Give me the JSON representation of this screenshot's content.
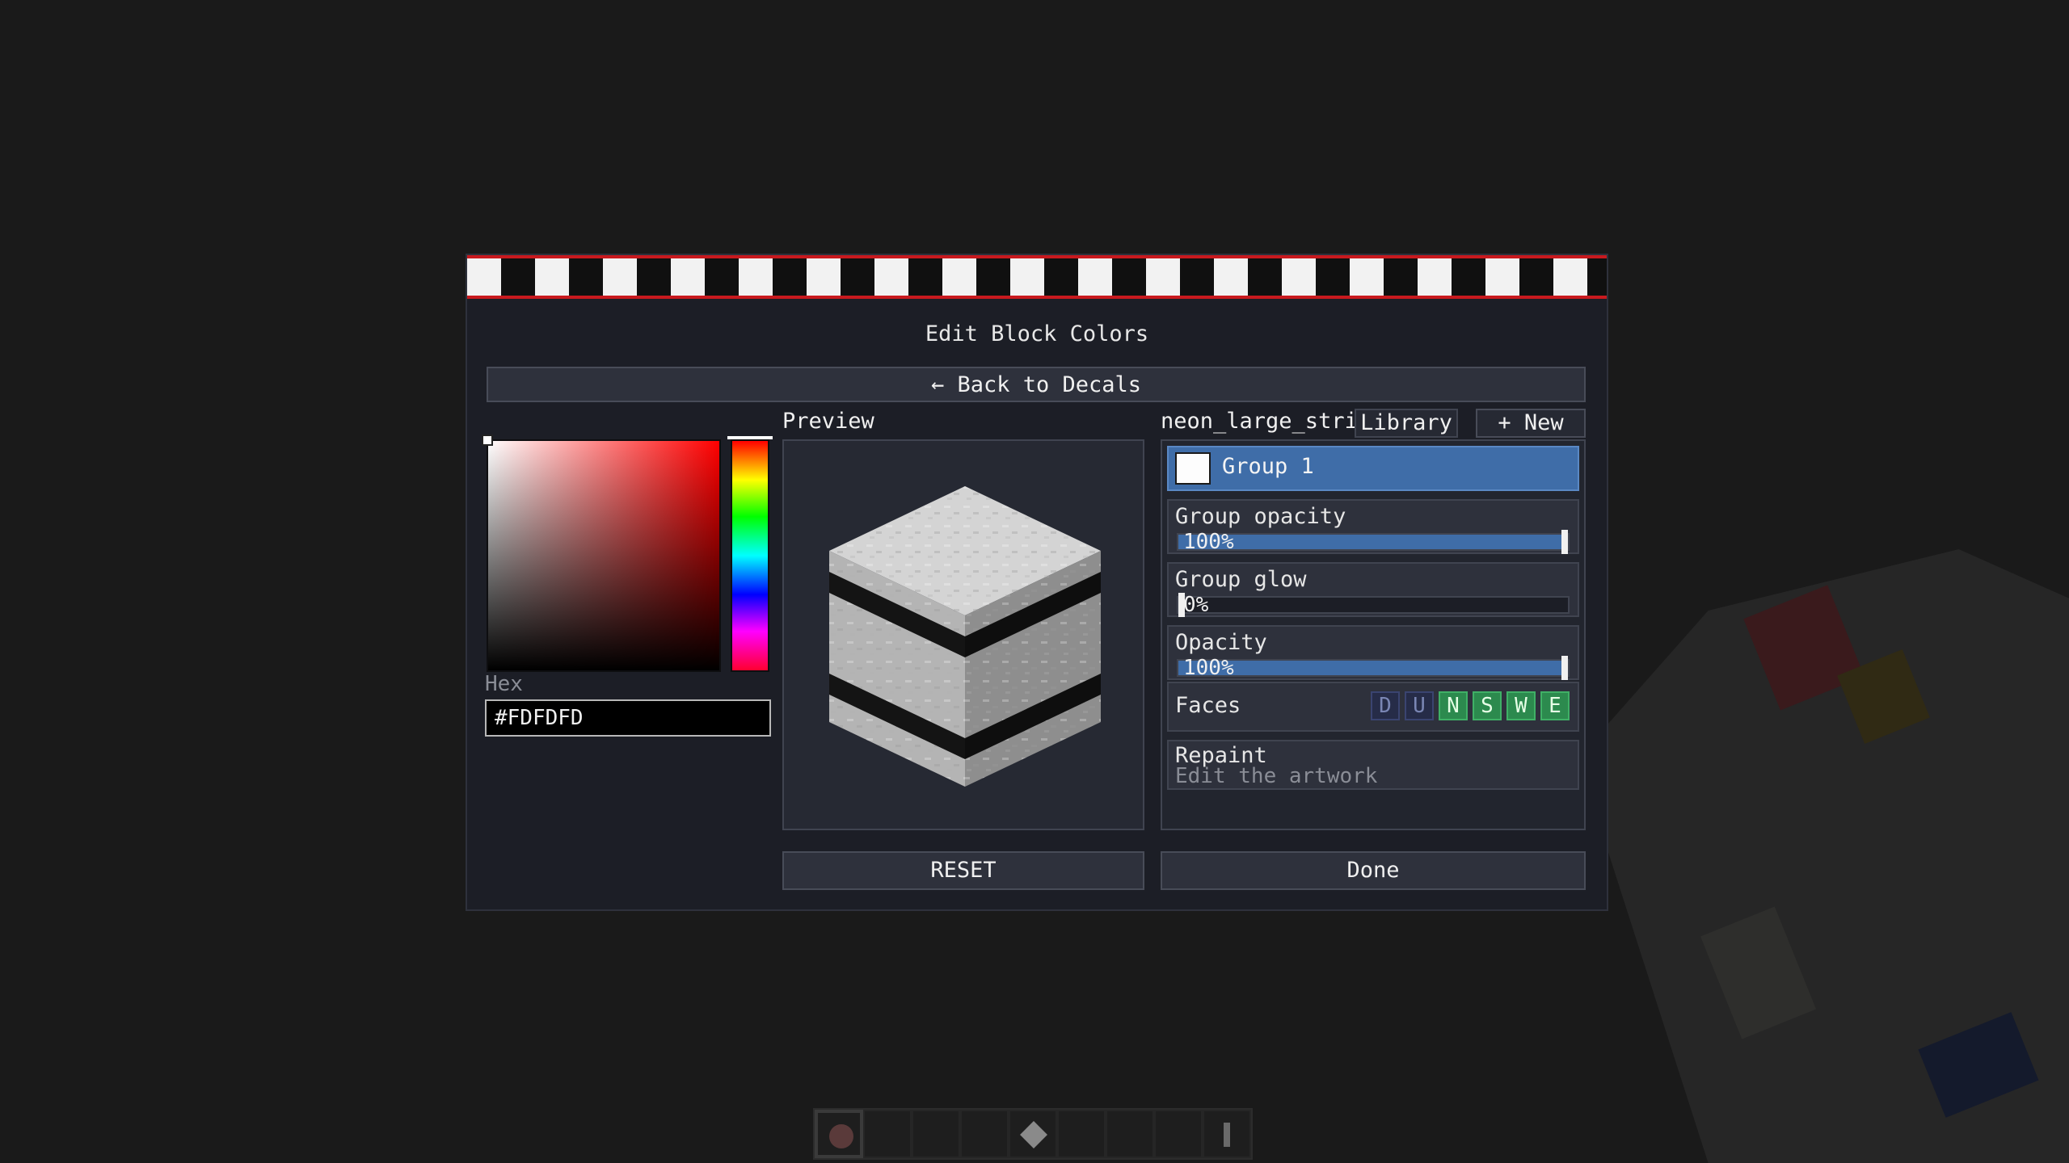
{
  "dialog": {
    "title": "Edit Block Colors",
    "back_label": "← Back to Decals"
  },
  "picker": {
    "hex_label": "Hex",
    "hex_value": "#FDFDFD"
  },
  "preview": {
    "label": "Preview"
  },
  "decal": {
    "name": "neon_large_strip",
    "library_label": "Library",
    "new_label": "+ New"
  },
  "group": {
    "name": "Group 1",
    "color": "#FDFDFD"
  },
  "sliders": {
    "group_opacity": {
      "label": "Group opacity",
      "value_text": "100%",
      "value": 1.0
    },
    "group_glow": {
      "label": "Group glow",
      "value_text": "0%",
      "value": 0.0
    },
    "opacity": {
      "label": "Opacity",
      "value_text": "100%",
      "value": 1.0
    }
  },
  "faces": {
    "label": "Faces",
    "buttons": [
      {
        "letter": "D",
        "enabled": false
      },
      {
        "letter": "U",
        "enabled": false
      },
      {
        "letter": "N",
        "enabled": true
      },
      {
        "letter": "S",
        "enabled": true
      },
      {
        "letter": "W",
        "enabled": true
      },
      {
        "letter": "E",
        "enabled": true
      }
    ]
  },
  "repaint": {
    "title": "Repaint",
    "subtitle": "Edit the artwork"
  },
  "buttons": {
    "reset_label": "RESET",
    "done_label": "Done"
  },
  "colors": {
    "accent": "#3F6DA8",
    "stripe_red": "#C8191E",
    "face_on": "#2C8A4E",
    "face_off": "#262C48"
  },
  "hotbar": {
    "selected_slot": 0,
    "slot_count": 9
  }
}
